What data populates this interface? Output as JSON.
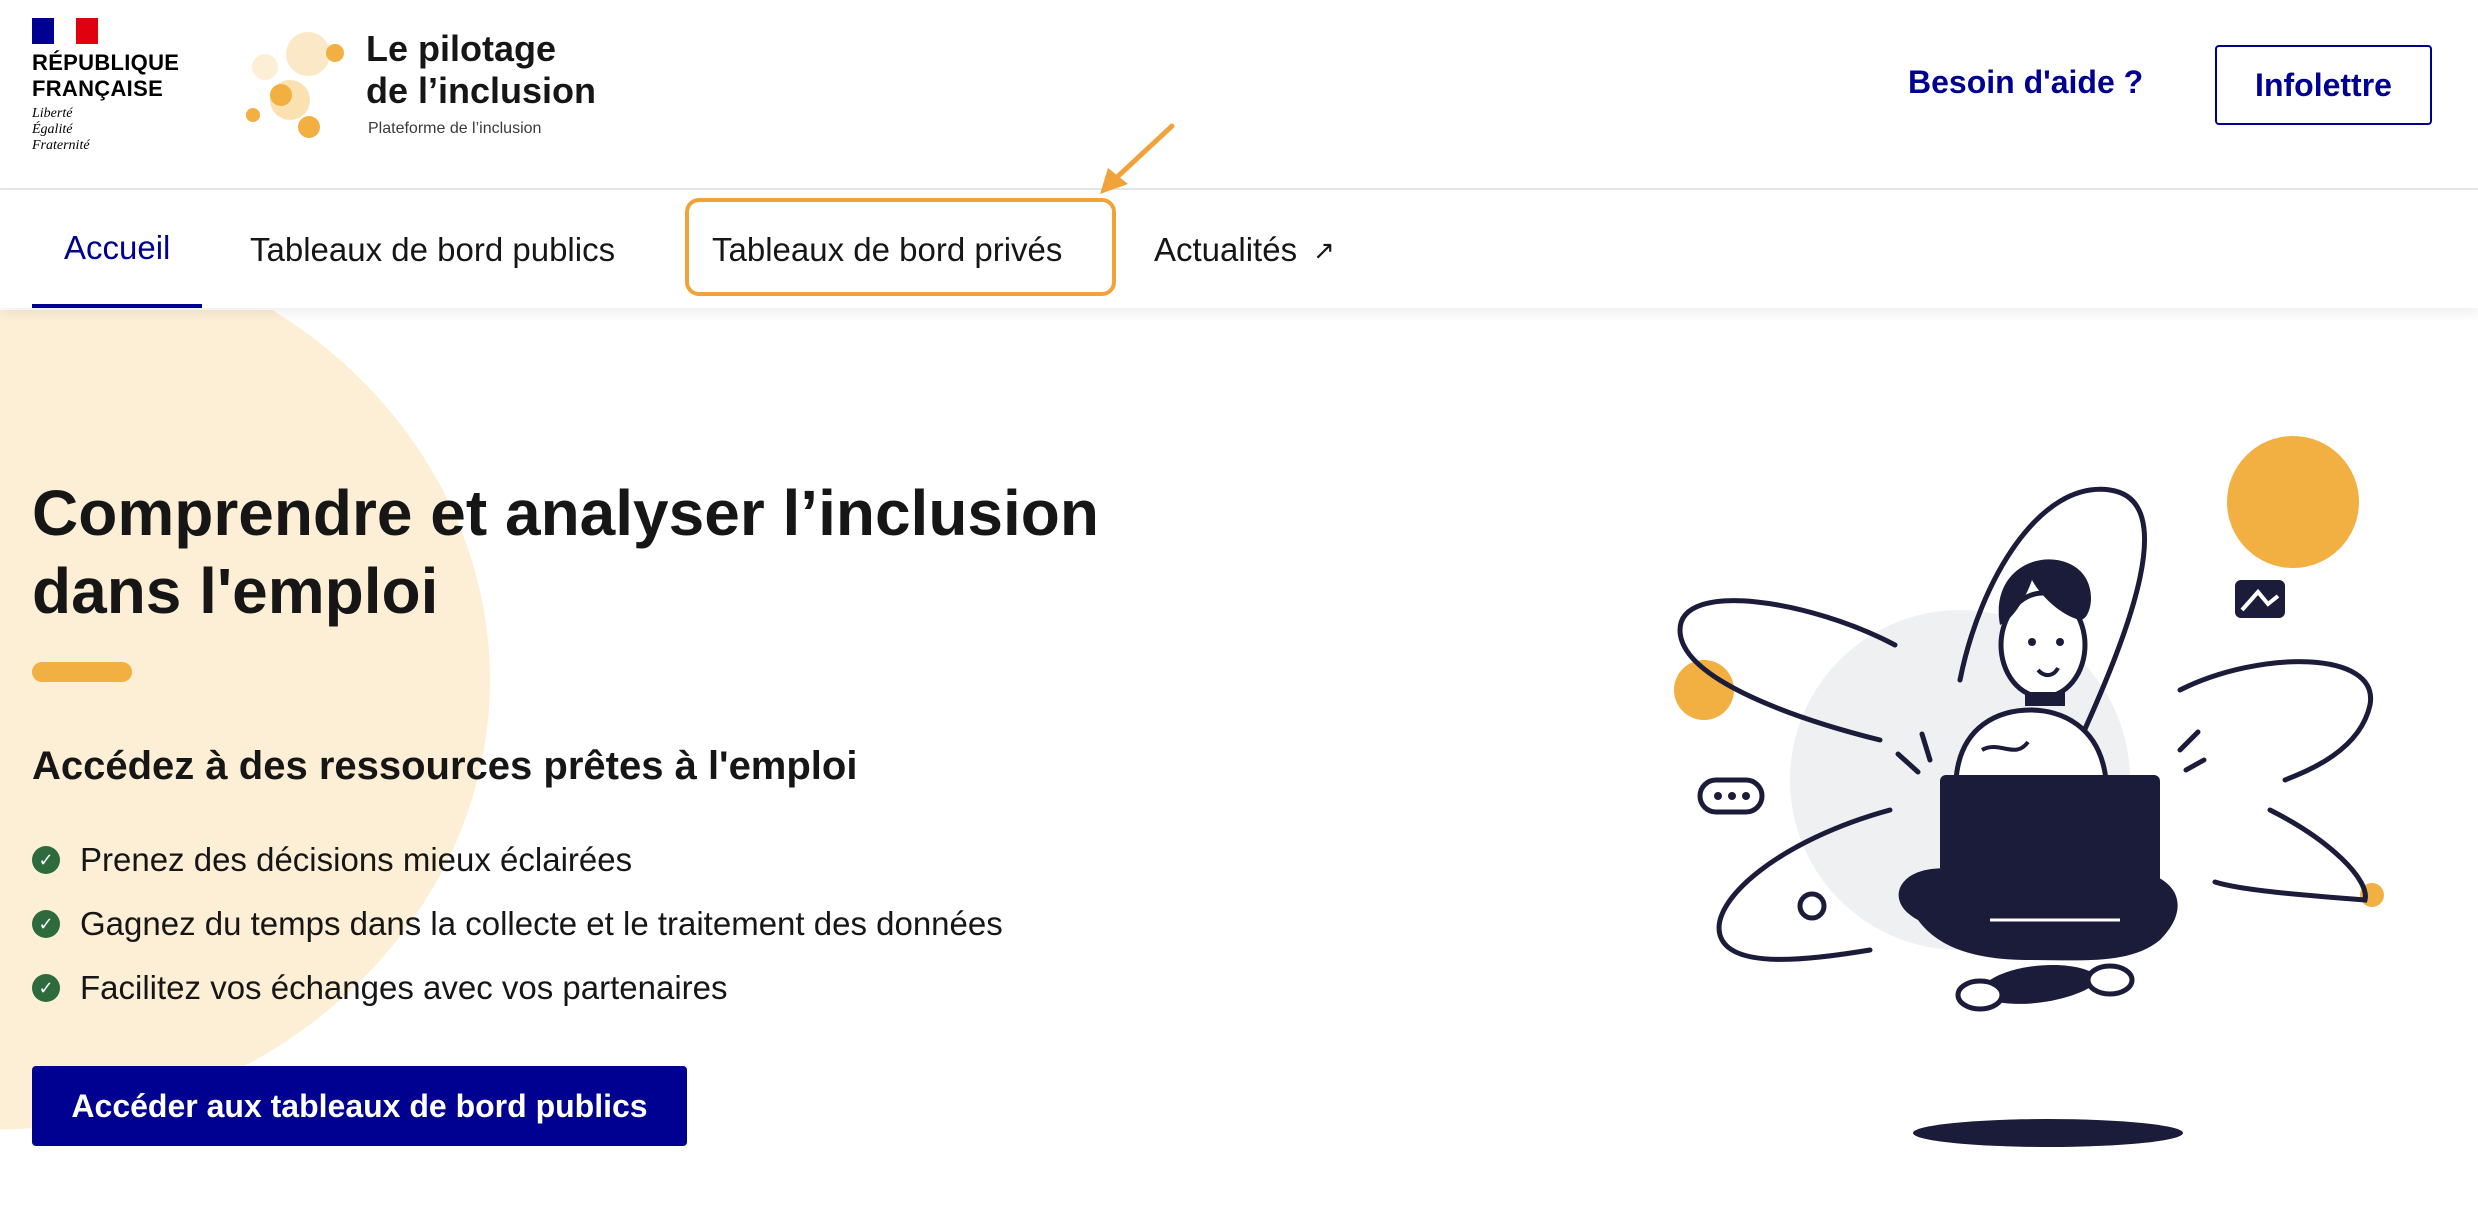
{
  "header": {
    "gov_logo": {
      "line1": "RÉPUBLIQUE",
      "line2": "FRANÇAISE",
      "motto": [
        "Liberté",
        "Égalité",
        "Fraternité"
      ]
    },
    "brand": {
      "title_line1": "Le pilotage",
      "title_line2": "de l’inclusion",
      "tagline": "Plateforme de l’inclusion"
    },
    "help_label": "Besoin d'aide ?",
    "newsletter_label": "Infolettre"
  },
  "nav": {
    "items": [
      {
        "label": "Accueil",
        "active": true
      },
      {
        "label": "Tableaux de bord publics"
      },
      {
        "label": "Tableaux de bord privés",
        "highlighted": true
      },
      {
        "label": "Actualités",
        "icon": "external-link-icon"
      }
    ]
  },
  "hero": {
    "title_line1": "Comprendre et analyser l’inclusion",
    "title_line2": "dans l'emploi",
    "subtitle": "Accédez à des ressources prêtes à l'emploi",
    "benefits": [
      "Prenez des décisions mieux éclairées",
      "Gagnez du temps dans la collecte et le traitement des données",
      "Facilitez vos échanges avec vos partenaires"
    ],
    "cta_label": "Accéder aux tableaux de bord publics"
  },
  "colors": {
    "primary": "#000091",
    "accent_orange": "#f1a33a",
    "hero_bg": "#fdefd6",
    "check_green": "#2d6a3e",
    "ink": "#161616"
  }
}
